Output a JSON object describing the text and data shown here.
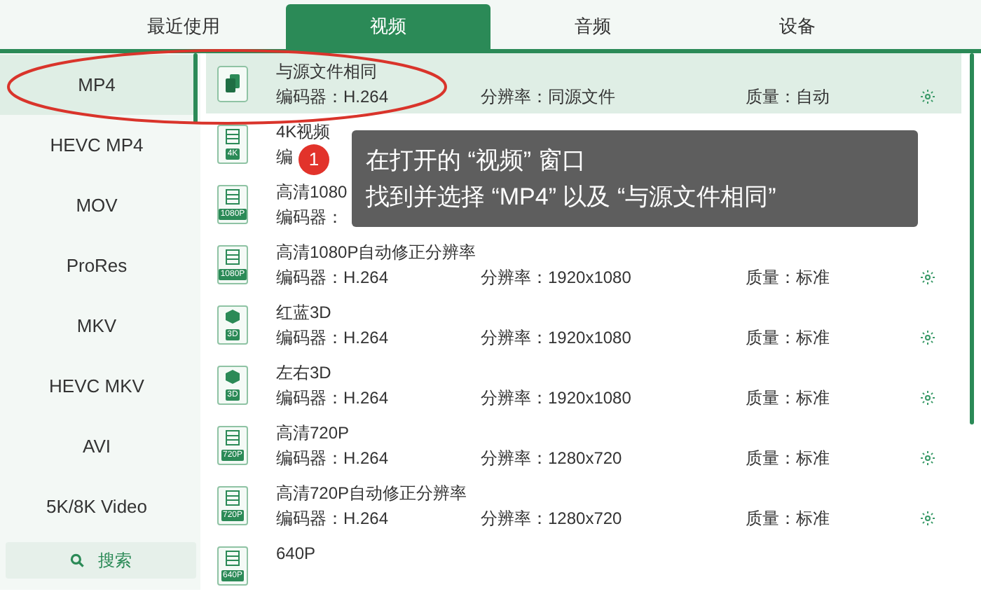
{
  "tabs": [
    {
      "label": "最近使用",
      "selected": false
    },
    {
      "label": "视频",
      "selected": true
    },
    {
      "label": "音频",
      "selected": false
    },
    {
      "label": "设备",
      "selected": false
    }
  ],
  "sidebar": {
    "items": [
      {
        "label": "MP4",
        "selected": true
      },
      {
        "label": "HEVC MP4",
        "selected": false
      },
      {
        "label": "MOV",
        "selected": false
      },
      {
        "label": "ProRes",
        "selected": false
      },
      {
        "label": "MKV",
        "selected": false
      },
      {
        "label": "HEVC MKV",
        "selected": false
      },
      {
        "label": "AVI",
        "selected": false
      },
      {
        "label": "5K/8K Video",
        "selected": false
      }
    ],
    "search_button": "搜索"
  },
  "presets": [
    {
      "kind": "copy",
      "title": "与源文件相同",
      "encoder": "编码器：H.264",
      "resolution": "分辨率：同源文件",
      "quality": "质量：自动",
      "selected": true
    },
    {
      "kind": "film",
      "badge": "4K",
      "title": "4K视频",
      "encoder": "编",
      "selected": false
    },
    {
      "kind": "film",
      "badge": "1080P",
      "title": "高清1080",
      "encoder": "编码器：",
      "selected": false
    },
    {
      "kind": "film",
      "badge": "1080P",
      "title": "高清1080P自动修正分辨率",
      "encoder": "编码器：H.264",
      "resolution": "分辨率：1920x1080",
      "quality": "质量：标准",
      "selected": false
    },
    {
      "kind": "cube",
      "badge": "3D",
      "title": "红蓝3D",
      "encoder": "编码器：H.264",
      "resolution": "分辨率：1920x1080",
      "quality": "质量：标准",
      "selected": false
    },
    {
      "kind": "cube",
      "badge": "3D",
      "title": "左右3D",
      "encoder": "编码器：H.264",
      "resolution": "分辨率：1920x1080",
      "quality": "质量：标准",
      "selected": false
    },
    {
      "kind": "film",
      "badge": "720P",
      "title": "高清720P",
      "encoder": "编码器：H.264",
      "resolution": "分辨率：1280x720",
      "quality": "质量：标准",
      "selected": false
    },
    {
      "kind": "film",
      "badge": "720P",
      "title": "高清720P自动修正分辨率",
      "encoder": "编码器：H.264",
      "resolution": "分辨率：1280x720",
      "quality": "质量：标准",
      "selected": false
    },
    {
      "kind": "film",
      "badge": "640P",
      "title": "640P",
      "selected": false
    }
  ],
  "callout": {
    "step": "1",
    "lines": [
      "在打开的 “视频” 窗口",
      "找到并选择 “MP4” 以及 “与源文件相同”"
    ]
  }
}
